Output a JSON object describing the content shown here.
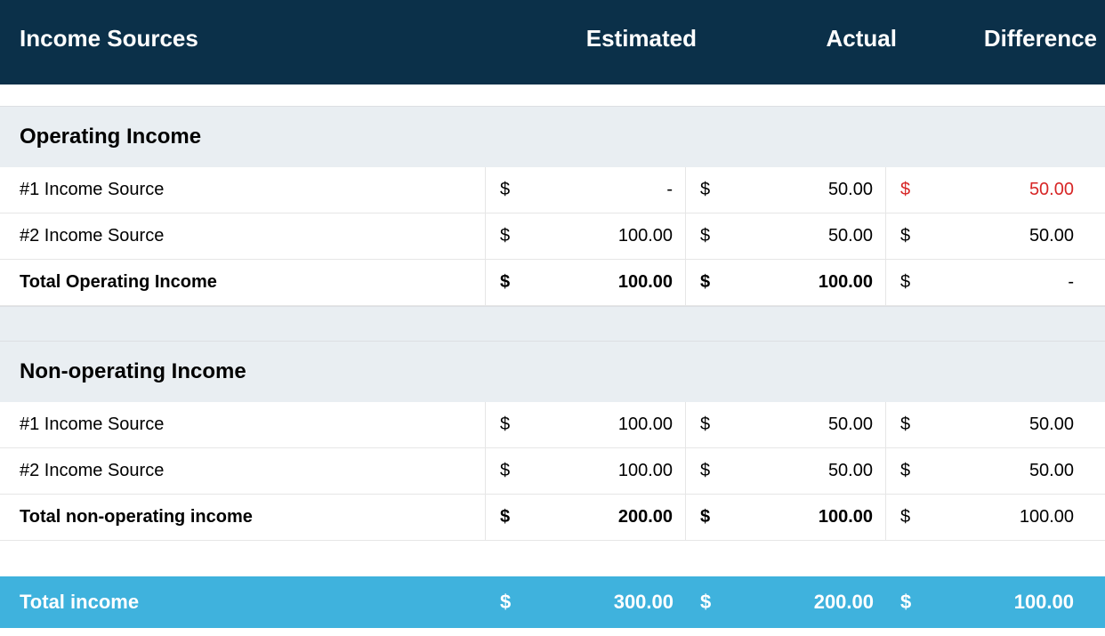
{
  "header": {
    "title": "Income Sources",
    "col1": "Estimated",
    "col2": "Actual",
    "col3": "Difference"
  },
  "currency": "$",
  "sections": [
    {
      "title": "Operating Income",
      "rows": [
        {
          "label": "#1 Income Source",
          "estimated": "-",
          "actual": "50.00",
          "difference": "50.00",
          "diff_negative": true
        },
        {
          "label": "#2 Income Source",
          "estimated": "100.00",
          "actual": "50.00",
          "difference": "50.00",
          "diff_negative": false
        }
      ],
      "total": {
        "label": "Total Operating Income",
        "estimated": "100.00",
        "actual": "100.00",
        "difference": "-"
      }
    },
    {
      "title": "Non-operating Income",
      "rows": [
        {
          "label": "#1 Income Source",
          "estimated": "100.00",
          "actual": "50.00",
          "difference": "50.00",
          "diff_negative": false
        },
        {
          "label": "#2 Income Source",
          "estimated": "100.00",
          "actual": "50.00",
          "difference": "50.00",
          "diff_negative": false
        }
      ],
      "total": {
        "label": "Total non-operating income",
        "estimated": "200.00",
        "actual": "100.00",
        "difference": "100.00"
      }
    }
  ],
  "grand_total": {
    "label": "Total income",
    "estimated": "300.00",
    "actual": "200.00",
    "difference": "100.00"
  }
}
